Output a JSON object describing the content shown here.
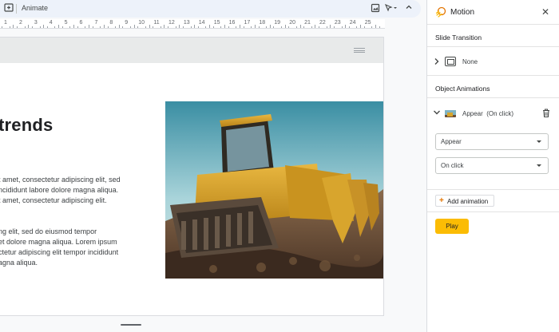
{
  "toolbar": {
    "animate_label": "Animate"
  },
  "ruler": {
    "numbers": [
      "1",
      "2",
      "3",
      "4",
      "5",
      "6",
      "7",
      "8",
      "9",
      "10",
      "11",
      "12",
      "13",
      "14",
      "15",
      "16",
      "17",
      "18",
      "19",
      "20",
      "21",
      "22",
      "23",
      "24",
      "25"
    ]
  },
  "slide": {
    "title": "trends",
    "paragraph_1": [
      "t amet, consectetur adipiscing elit, sed",
      "ncididunt labore dolore magna aliqua.",
      "t amet, consectetur adipiscing elit."
    ],
    "paragraph_2": [
      "ng elit, sed do eiusmod tempor",
      "et dolore magna aliqua. Lorem ipsum",
      "ctetur adipiscing elit tempor incididunt",
      "agna aliqua."
    ]
  },
  "panel": {
    "title": "Motion",
    "slide_transition_label": "Slide Transition",
    "transition_value": "None",
    "object_animations_label": "Object Animations",
    "animation_name": "Appear",
    "animation_trigger": "(On click)",
    "effect_select": "Appear",
    "trigger_select": "On click",
    "add_animation_label": "Add animation",
    "play_label": "Play"
  },
  "colors": {
    "accent": "#fbbc04",
    "toolbar_bg": "#edf2fa"
  }
}
